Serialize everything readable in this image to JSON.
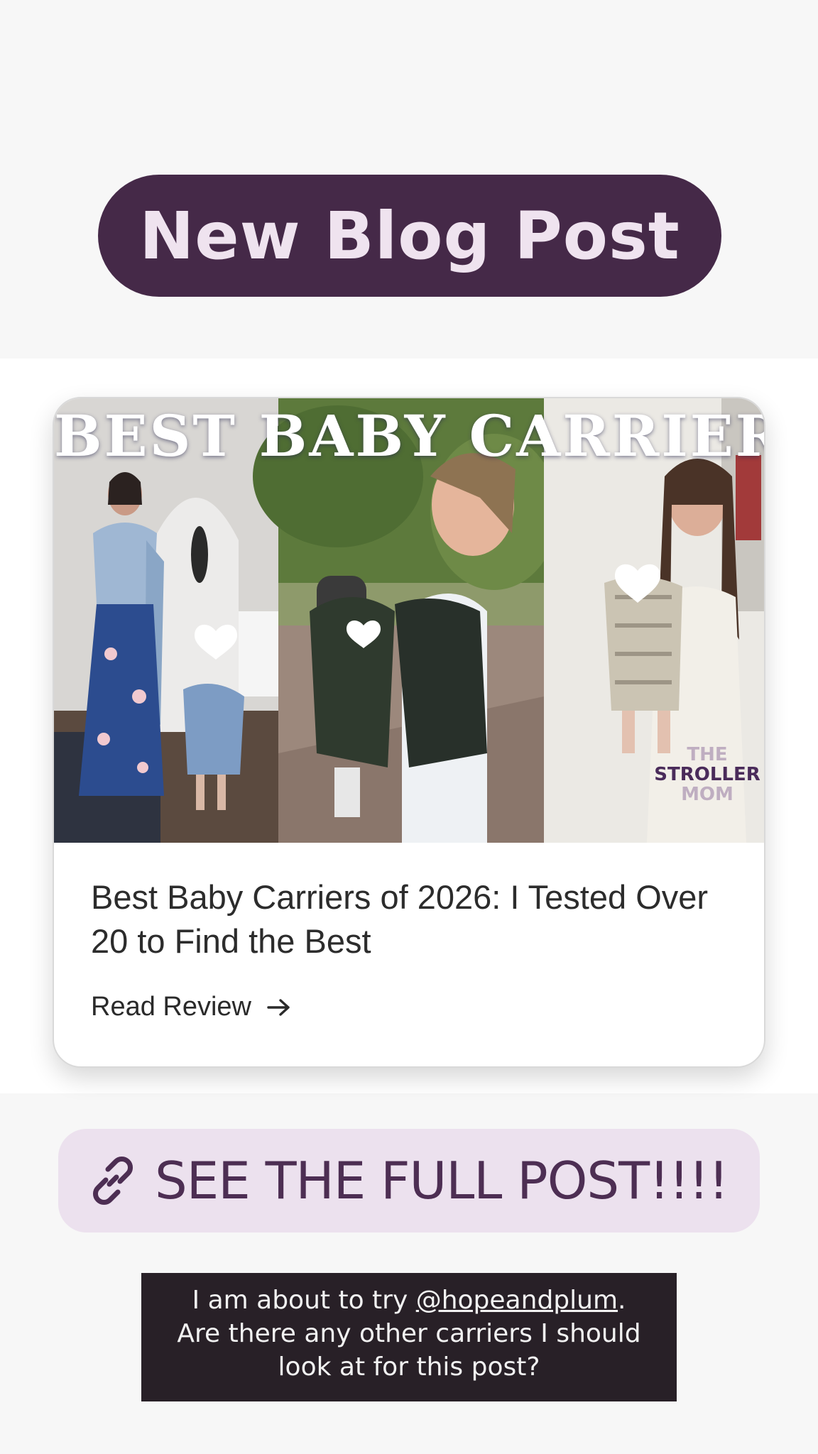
{
  "header": {
    "title": "New Blog Post"
  },
  "card": {
    "hero_title": "BEST BABY CARRIERS",
    "watermark": [
      "THE",
      "STROLLER",
      "MOM"
    ],
    "title": "Best Baby Carriers of 2026: I Tested Over 20 to Find the Best",
    "read_label": "Read Review"
  },
  "link_sticker": {
    "label": "SEE THE FULL POST!!!!"
  },
  "caption": {
    "line1_prefix": "I am about to try ",
    "mention": "@hopeandplum",
    "line1_suffix": ".",
    "line2": "Are there any other carriers I should",
    "line3": "look at for this post?"
  },
  "colors": {
    "header_bg": "#452948",
    "header_text": "#efe3ef",
    "sticker_bg": "#ece1ee",
    "sticker_text": "#4d2e53",
    "caption_bg": "#282027"
  },
  "icons": [
    "arrow-right-icon",
    "link-icon",
    "heart-icon"
  ]
}
